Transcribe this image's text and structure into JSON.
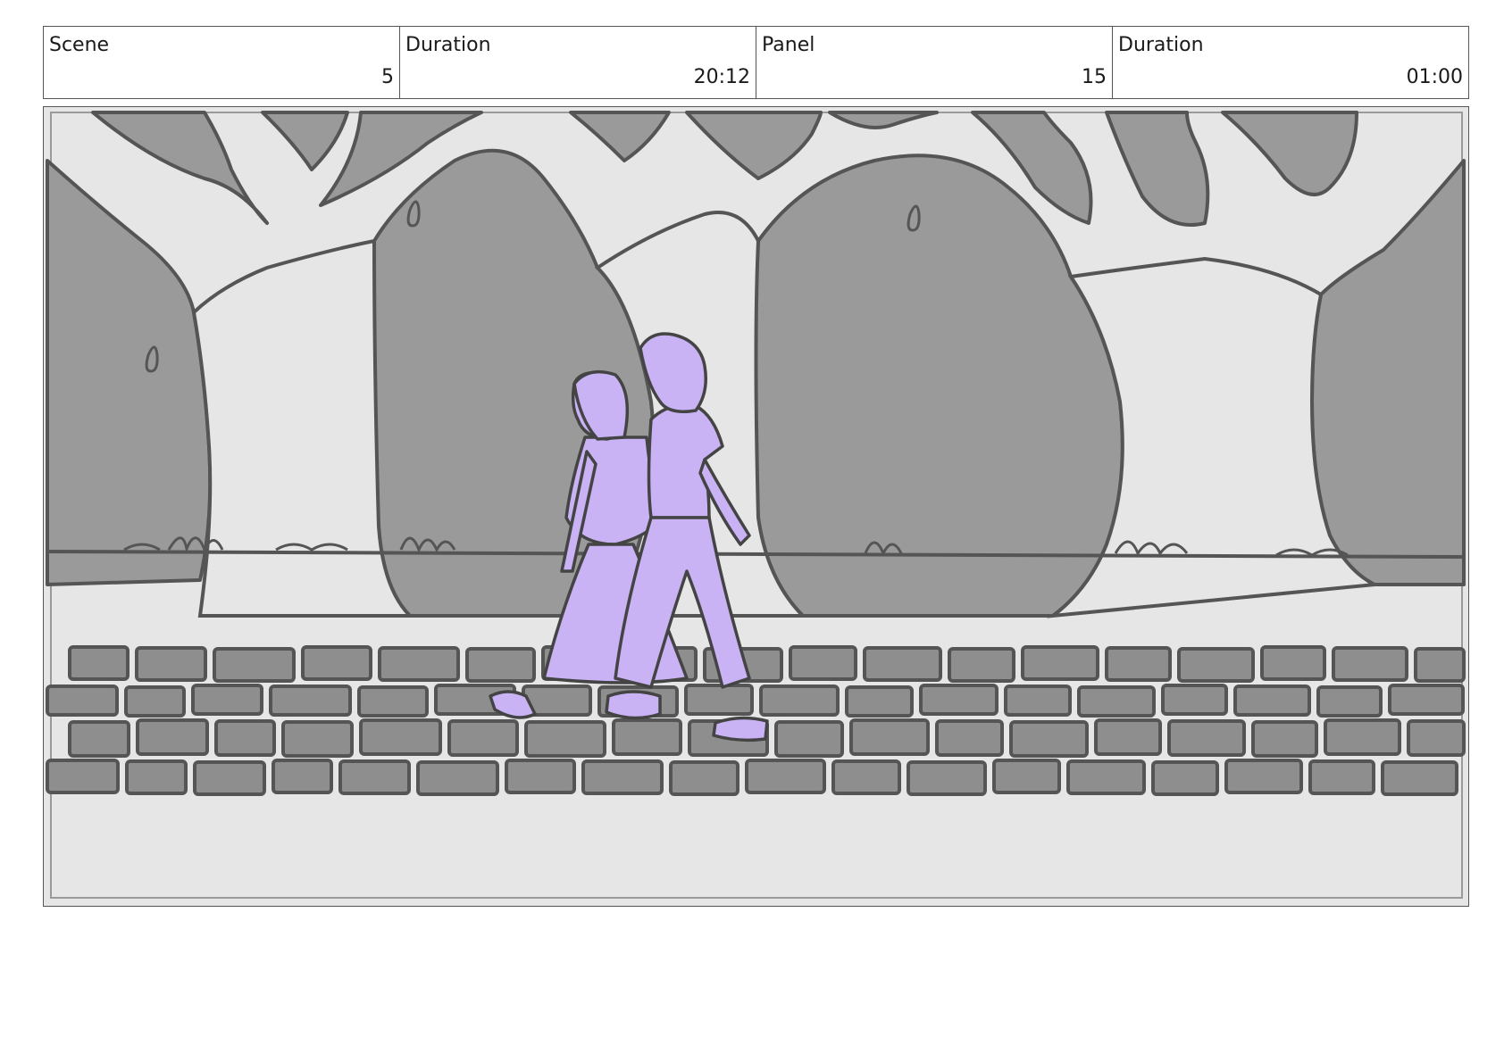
{
  "header": {
    "scene_label": "Scene",
    "scene_value": "5",
    "scene_duration_label": "Duration",
    "scene_duration_value": "20:12",
    "panel_label": "Panel",
    "panel_value": "15",
    "panel_duration_label": "Duration",
    "panel_duration_value": "01:00"
  },
  "colors": {
    "foliage": "#9a9a9a",
    "sky": "#e6e6e6",
    "outline": "#555555",
    "characters": "#c9b3f5",
    "paving": "#8e8e8e"
  }
}
